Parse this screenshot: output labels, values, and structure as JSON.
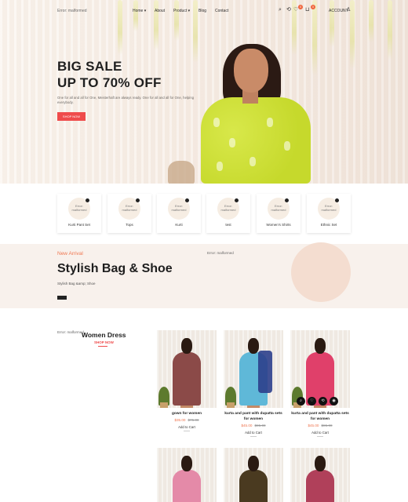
{
  "header": {
    "logo_alt": "Error: malformed",
    "nav": [
      "Home ▾",
      "About",
      "Product ▾",
      "Blog",
      "Contact"
    ],
    "icons": [
      "search-icon",
      "refresh-icon",
      "heart-icon",
      "cart-icon"
    ],
    "wishlist_count": "0",
    "cart_count": "0",
    "account_label": "ACCOUNT"
  },
  "hero": {
    "title_line1": "BIG SALE",
    "title_line2": "UP TO 70% OFF",
    "description": "One for all and all for One, Meisterhaft are always ready. One for all and all for One, helping everybody.",
    "button_label": "SHOP NOW"
  },
  "categories": [
    {
      "image_alt": "Error: malformed",
      "label": "Kurti Pant Set"
    },
    {
      "image_alt": "Error: malformed",
      "label": "Tops"
    },
    {
      "image_alt": "Error: malformed",
      "label": "Kurti"
    },
    {
      "image_alt": "Error: malformed",
      "label": "test"
    },
    {
      "image_alt": "Error: malformed",
      "label": "Women's Shirts"
    },
    {
      "image_alt": "Error: malformed",
      "label": "Ethnic Set"
    }
  ],
  "banner": {
    "eyebrow": "New Arrival",
    "title": "Stylish Bag & Shoe",
    "subtitle": "Stylish Bag &amp; Shoe",
    "image_alt": "Error: malformed"
  },
  "women_dress": {
    "image_alt": "Error: malformed",
    "title": "Women Dress",
    "shop_now": "SHOP NOW"
  },
  "products": [
    {
      "name": "gown for women",
      "price": "$35.00",
      "old_price": "$75.00",
      "cart": "Add to Cart",
      "dress_color": "#8b4a48"
    },
    {
      "name": "kurta and pant with dupatta sets for women",
      "price": "$45.00",
      "old_price": "$85.00",
      "cart": "Add to Cart",
      "dress_color": "#5fb8d8"
    },
    {
      "name": "kurta and pant with dupatta sets for women",
      "price": "$45.00",
      "old_price": "$85.00",
      "cart": "Add to Cart",
      "dress_color": "#e0406a"
    }
  ],
  "products_row2": [
    {
      "dress_color": "#e48aa8"
    },
    {
      "dress_color": "#4a3a20"
    },
    {
      "dress_color": "#b0405a"
    }
  ],
  "card_action_icons": [
    "search-icon",
    "heart-icon",
    "refresh-icon",
    "eye-icon"
  ],
  "colors": {
    "accent": "#ef4b4b",
    "highlight": "#ef7650",
    "banner_bg": "#f8f1ec"
  }
}
